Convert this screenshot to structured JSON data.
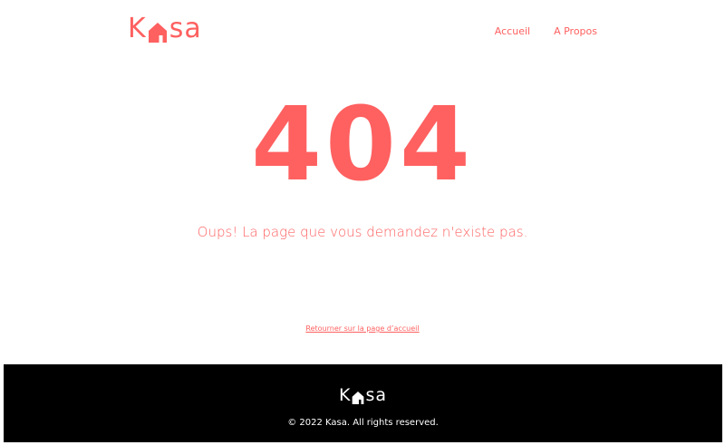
{
  "header": {
    "logo": {
      "left": "K",
      "right": "sa",
      "icon": "house-icon"
    },
    "nav": [
      {
        "label": "Accueil"
      },
      {
        "label": "A Propos"
      }
    ]
  },
  "main": {
    "error_code": "404",
    "message": "Oups! La page que vous demandez n'existe pas.",
    "back_link": "Retourner sur la page d’accueil"
  },
  "footer": {
    "logo": {
      "left": "K",
      "right": "sa",
      "icon": "house-icon"
    },
    "copyright": "© 2022 Kasa. All rights reserved."
  },
  "colors": {
    "accent": "#ff6060",
    "footer_bg": "#000000",
    "footer_text": "#ffffff"
  }
}
